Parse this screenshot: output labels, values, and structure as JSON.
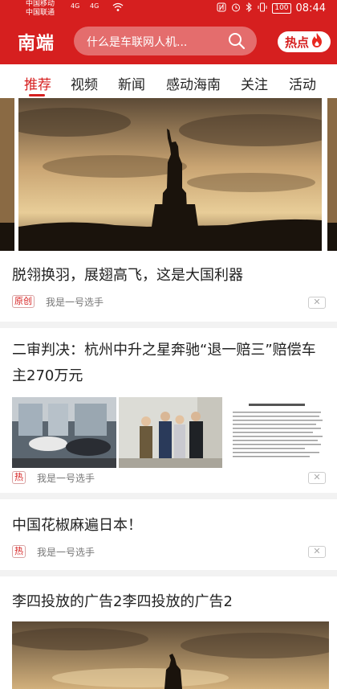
{
  "status_bar": {
    "carrier_1": "中国移动",
    "carrier_2": "中国联通",
    "net_a": "4G",
    "net_b": "4G",
    "battery": "100",
    "time": "08:44"
  },
  "header": {
    "brand": "南端",
    "search_placeholder": "什么是车联网人机...",
    "hot_label": "热点"
  },
  "tabs": [
    "推荐",
    "视频",
    "新闻",
    "感动海南",
    "关注",
    "活动"
  ],
  "articles": [
    {
      "title": "脱翎换羽，展翅高飞，这是大国利器",
      "tag": "原创",
      "source": "我是一号选手"
    },
    {
      "title": "二审判决：杭州中升之星奔驰“退一赔三”赔偿车主270万元",
      "tag": "热",
      "source": "我是一号选手"
    },
    {
      "title": "中国花椒麻遍日本！",
      "tag": "热",
      "source": "我是一号选手"
    },
    {
      "title": "李四投放的广告2李四投放的广告2"
    }
  ],
  "colors": {
    "brand_red": "#d61f1f"
  }
}
